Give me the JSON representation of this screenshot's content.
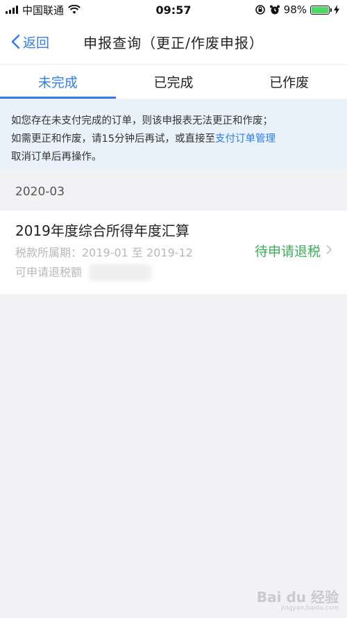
{
  "status_bar": {
    "carrier": "中国联通",
    "time": "09:57",
    "battery": "98%",
    "battery_level": 0.98
  },
  "nav": {
    "back_label": "返回",
    "title": "申报查询（更正/作废申报）"
  },
  "tabs": [
    {
      "label": "未完成",
      "active": true
    },
    {
      "label": "已完成",
      "active": false
    },
    {
      "label": "已作废",
      "active": false
    }
  ],
  "notice": {
    "line1": "如您存在未支付完成的订单，则该申报表无法更正和作废；",
    "line2_prefix": "如需更正和作废，请15分钟后再试，或直接至",
    "link": "支付订单管理",
    "line3": "取消订单后再操作。"
  },
  "section_date": "2020-03",
  "record": {
    "title": "2019年度综合所得年度汇算",
    "period": "税款所属期：2019-01 至 2019-12",
    "amount_label": "可申请退税额",
    "status": "待申请退税"
  },
  "watermark": {
    "main": "Bai du 经验",
    "sub": "jingyan.baidu.com"
  },
  "colors": {
    "accent": "#2f7bf2",
    "status_green": "#3dae5a",
    "notice_bg": "#e9f1fb",
    "page_bg": "#f2f2f5"
  }
}
